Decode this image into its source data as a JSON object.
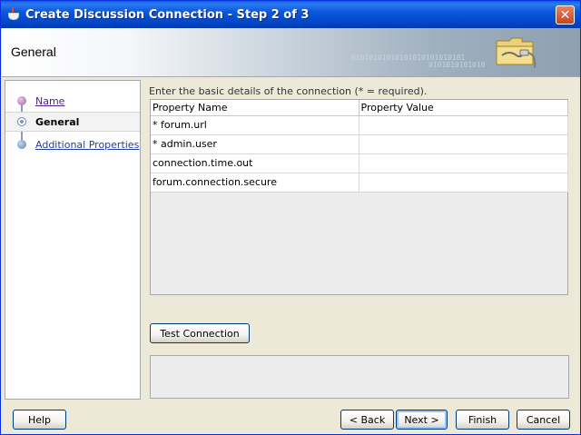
{
  "window": {
    "title": "Create Discussion Connection - Step 2 of 3",
    "close_glyph": "✕"
  },
  "header": {
    "title": "General",
    "binary_text_1": "01010101010101010101010101",
    "binary_text_2": "0101010101010"
  },
  "nav": {
    "items": [
      {
        "label": "Name",
        "state": "visited"
      },
      {
        "label": "General",
        "state": "current"
      },
      {
        "label": "Additional Properties",
        "state": "future"
      }
    ]
  },
  "main": {
    "instruction": "Enter the basic details of the connection (* = required).",
    "table": {
      "headers": [
        "Property Name",
        "Property Value"
      ],
      "rows": [
        {
          "name": "* forum.url",
          "value": ""
        },
        {
          "name": "* admin.user",
          "value": ""
        },
        {
          "name": "connection.time.out",
          "value": ""
        },
        {
          "name": "forum.connection.secure",
          "value": ""
        }
      ]
    },
    "test_connection_label": "Test Connection"
  },
  "footer": {
    "help_label": "Help",
    "back_label": "< Back",
    "next_label": "Next >",
    "finish_label": "Finish",
    "cancel_label": "Cancel"
  },
  "colors": {
    "titlebar": "#0b58dc",
    "close_button": "#c8431e",
    "visited_link": "#551a8b",
    "link": "#1f3fa0"
  },
  "icons": {
    "title": "coffee-cup-icon",
    "header": "folder-plug-icon",
    "close": "close-icon"
  }
}
